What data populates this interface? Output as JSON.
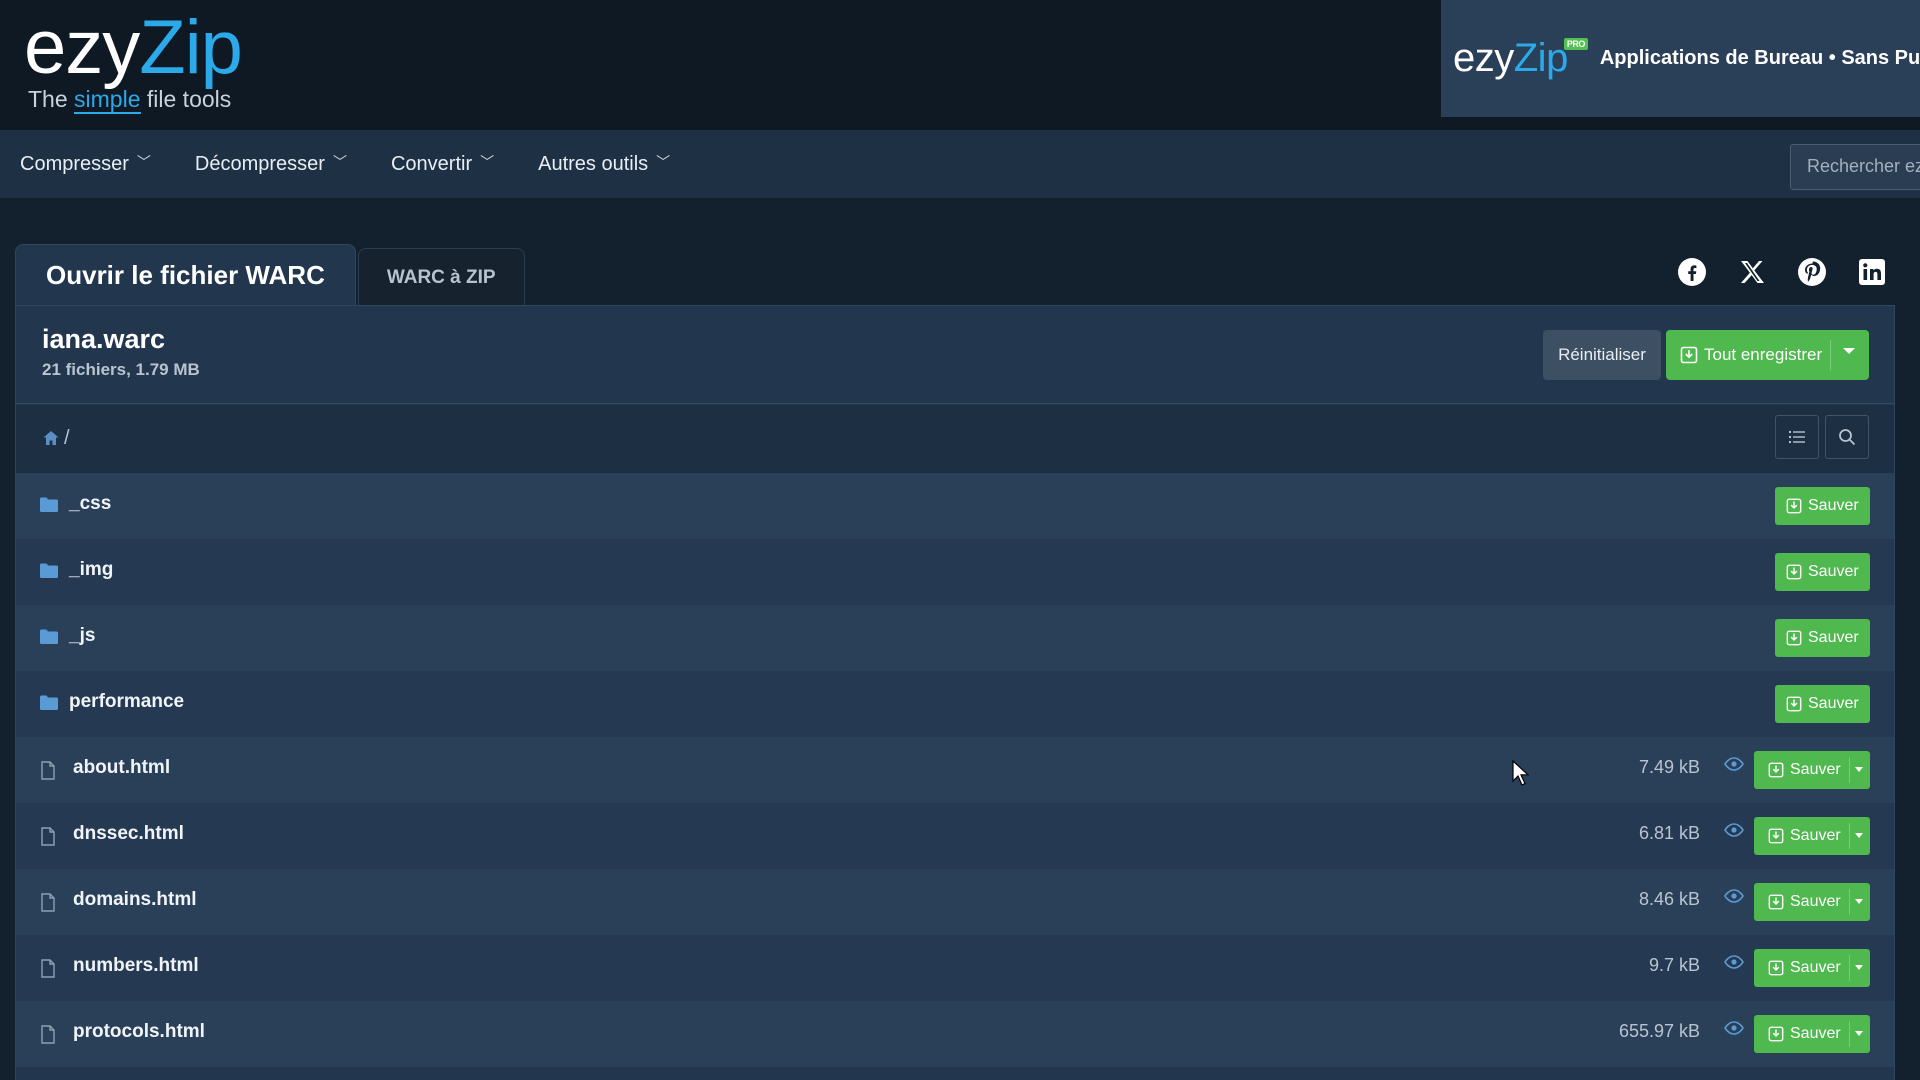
{
  "header": {
    "logo_main": "ezy",
    "logo_accent": "Zip",
    "tagline_prefix": "The ",
    "tagline_accent": "simple",
    "tagline_suffix": " file tools",
    "promo_logo_main": "ezy",
    "promo_logo_accent": "Zip",
    "promo_badge": "PRO",
    "promo_text": "Applications de Bureau • Sans Pub"
  },
  "nav": {
    "items": [
      {
        "label": "Compresser"
      },
      {
        "label": "Décompresser"
      },
      {
        "label": "Convertir"
      },
      {
        "label": "Autres outils"
      }
    ],
    "search_placeholder": "Rechercher ez"
  },
  "tabs": {
    "active": "Ouvrir le fichier WARC",
    "other": "WARC à ZIP"
  },
  "social": [
    "facebook-icon",
    "x-icon",
    "pinterest-icon",
    "linkedin-icon"
  ],
  "archive": {
    "name": "iana.warc",
    "meta": "21 fichiers, 1.79 MB",
    "reset_label": "Réinitialiser",
    "save_all_label": "Tout enregistrer",
    "path": "/"
  },
  "rows": [
    {
      "type": "folder",
      "name": "_css",
      "save": "Sauver"
    },
    {
      "type": "folder",
      "name": "_img",
      "save": "Sauver"
    },
    {
      "type": "folder",
      "name": "_js",
      "save": "Sauver"
    },
    {
      "type": "folder",
      "name": "performance",
      "save": "Sauver"
    },
    {
      "type": "file",
      "name": "about.html",
      "size": "7.49 kB",
      "save": "Sauver"
    },
    {
      "type": "file",
      "name": "dnssec.html",
      "size": "6.81 kB",
      "save": "Sauver"
    },
    {
      "type": "file",
      "name": "domains.html",
      "size": "8.46 kB",
      "save": "Sauver"
    },
    {
      "type": "file",
      "name": "numbers.html",
      "size": "9.7 kB",
      "save": "Sauver"
    },
    {
      "type": "file",
      "name": "protocols.html",
      "size": "655.97 kB",
      "save": "Sauver"
    }
  ],
  "colors": {
    "accent_blue": "#2ba9e8",
    "save_green": "#4fb84f",
    "panel": "#22374e",
    "background": "#13202e"
  }
}
